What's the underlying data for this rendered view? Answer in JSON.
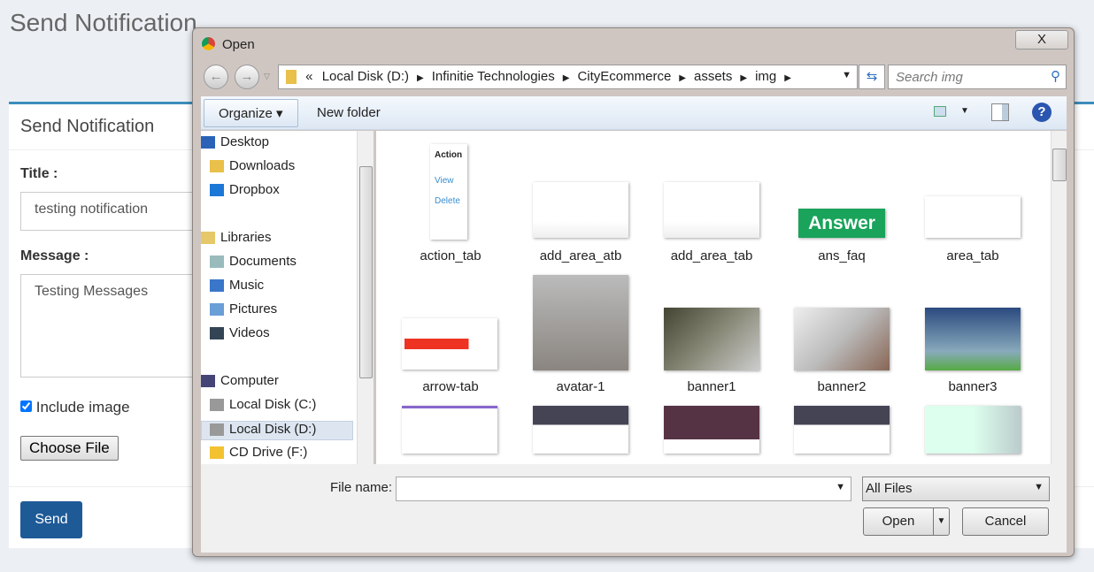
{
  "page": {
    "title": "Send Notification",
    "card_title": "Send Notification",
    "title_label": "Title :",
    "title_value": "testing notification",
    "message_label": "Message :",
    "message_value": "Testing Messages",
    "include_image_label": "Include image",
    "include_image_checked": true,
    "choose_file": "Choose File",
    "send": "Send",
    "accent": "#3c8dbc"
  },
  "dialog": {
    "title": "Open",
    "close": "X",
    "path": [
      "Local Disk (D:)",
      "Infinitie Technologies",
      "CityEcommerce",
      "assets",
      "img"
    ],
    "path_prefix": "«",
    "search_placeholder": "Search img",
    "organize": "Organize ▾",
    "new_folder": "New folder",
    "nav": [
      {
        "label": "Desktop",
        "icon": "desktop-icon"
      },
      {
        "label": "Downloads",
        "icon": "folder-icon"
      },
      {
        "label": "Dropbox",
        "icon": "dropbox-icon"
      },
      {
        "label": "Libraries",
        "icon": "libraries-icon"
      },
      {
        "label": "Documents",
        "icon": "documents-icon"
      },
      {
        "label": "Music",
        "icon": "music-icon"
      },
      {
        "label": "Pictures",
        "icon": "pictures-icon"
      },
      {
        "label": "Videos",
        "icon": "videos-icon"
      },
      {
        "label": "Computer",
        "icon": "computer-icon"
      },
      {
        "label": "Local Disk (C:)",
        "icon": "drive-icon"
      },
      {
        "label": "Local Disk (D:)",
        "icon": "drive-icon",
        "selected": true
      },
      {
        "label": "CD Drive (F:)",
        "icon": "cd-icon"
      }
    ],
    "files": [
      {
        "name": "action_tab",
        "thumb_text": [
          "Action",
          "View",
          "Delete"
        ]
      },
      {
        "name": "add_area_atb"
      },
      {
        "name": "add_area_tab"
      },
      {
        "name": "ans_faq",
        "thumb_text": [
          "Answer"
        ]
      },
      {
        "name": "area_tab"
      },
      {
        "name": "arrow-tab"
      },
      {
        "name": "avatar-1"
      },
      {
        "name": "banner1"
      },
      {
        "name": "banner2"
      },
      {
        "name": "banner3"
      },
      {
        "name": ""
      },
      {
        "name": ""
      },
      {
        "name": ""
      },
      {
        "name": ""
      },
      {
        "name": ""
      }
    ],
    "file_name_label": "File name:",
    "file_name_value": "",
    "file_type": "All Files",
    "open": "Open",
    "cancel": "Cancel"
  }
}
